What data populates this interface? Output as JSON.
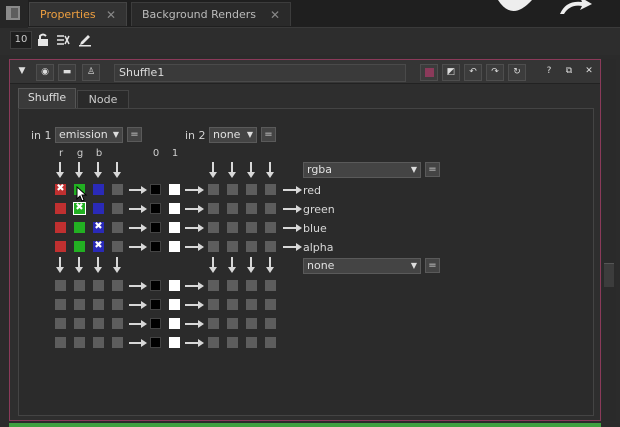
{
  "tabs": {
    "properties": "Properties",
    "background": "Background Renders",
    "close": "✕"
  },
  "toolbar": {
    "count": "10"
  },
  "node": {
    "name": "Shuffle1",
    "subtabs": {
      "shuffle": "Shuffle",
      "node": "Node"
    }
  },
  "shuffle": {
    "in1_label": "in 1",
    "in1_value": "emission",
    "in2_label": "in 2",
    "in2_value": "none",
    "eq": "=",
    "col_labels": [
      "r",
      "g",
      "b",
      "0",
      "1"
    ],
    "out1_value": "rgba",
    "out2_value": "none",
    "outputs": [
      "red",
      "green",
      "blue",
      "alpha"
    ],
    "active_row_colors": [
      "#c03030",
      "#22b022",
      "#2a2ab8"
    ],
    "checked": [
      [
        "red",
        "r"
      ],
      [
        "green",
        "g"
      ],
      [
        "blue",
        "b"
      ],
      [
        "alpha",
        "b"
      ]
    ]
  },
  "icons": {
    "lock": "lock-icon",
    "pencil": "pencil-icon",
    "undo": "undo-icon",
    "redo": "redo-icon"
  }
}
